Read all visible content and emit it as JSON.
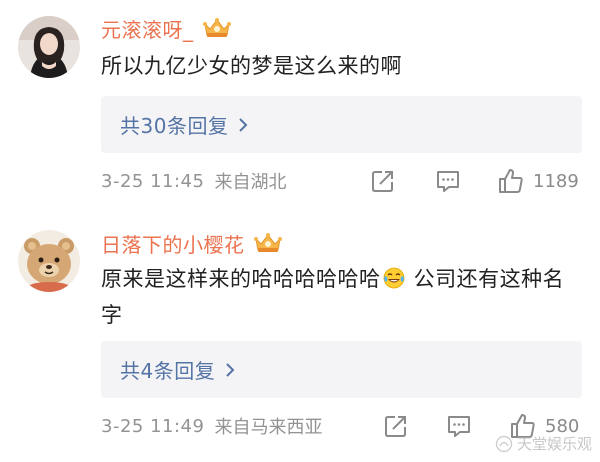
{
  "comments": [
    {
      "username": "元滚滚呀_",
      "text": "所以九亿少女的梦是这么来的啊",
      "replies_label": "共30条回复",
      "time": "3-25 11:45",
      "location": "来自湖北",
      "likes": "1189"
    },
    {
      "username": "日落下的小樱花",
      "text_before_emoji": "原来是这样来的哈哈哈哈哈哈",
      "emoji": "laughing-tears-emoji",
      "text_after_emoji": " 公司还有这种名字",
      "replies_label": "共4条回复",
      "time": "3-25 11:49",
      "location": "来自马来西亚",
      "likes": "580"
    }
  ],
  "watermark": "天堂娱乐观",
  "colors": {
    "username": "#eb7350",
    "link": "#5574a6",
    "meta": "#939393",
    "reply_bg": "#f4f4f6"
  },
  "icons": [
    "vip-crown-badge",
    "repost-icon",
    "comment-icon",
    "like-icon",
    "chevron-right-icon"
  ]
}
